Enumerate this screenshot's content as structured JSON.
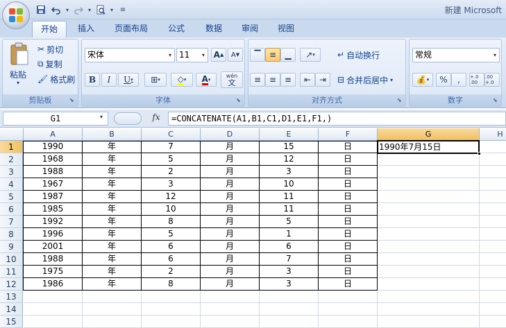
{
  "window": {
    "title": "新建 Microsoft"
  },
  "quick_access": {
    "save": "save-icon",
    "undo": "undo-icon",
    "redo": "redo-icon",
    "preview": "print-preview-icon"
  },
  "tabs": [
    "开始",
    "插入",
    "页面布局",
    "公式",
    "数据",
    "审阅",
    "视图"
  ],
  "ribbon": {
    "clipboard": {
      "paste": "粘贴",
      "cut": "剪切",
      "copy": "复制",
      "format_painter": "格式刷",
      "label": "剪贴板"
    },
    "font": {
      "name": "宋体",
      "size": "11",
      "label": "字体",
      "bold": "B",
      "italic": "I",
      "underline": "U",
      "font_color_letter": "A",
      "phonetic": "wén",
      "phonetic_char": "文"
    },
    "alignment": {
      "wrap": "自动换行",
      "merge": "合并后居中",
      "label": "对齐方式"
    },
    "number": {
      "format": "常规",
      "percent": "%",
      "comma": ",",
      "inc_decimal": "+.0 .00",
      "dec_decimal": ".00 +.0",
      "label": "数字"
    },
    "grow_font": "A",
    "shrink_font": "A"
  },
  "formula_bar": {
    "name_box": "G1",
    "fx": "fx",
    "formula": "=CONCATENATE(A1,B1,C1,D1,E1,F1,)"
  },
  "columns": [
    "A",
    "B",
    "C",
    "D",
    "E",
    "F",
    "G",
    "H"
  ],
  "rows": [
    {
      "n": "1",
      "cells": [
        "1990",
        "年",
        "7",
        "月",
        "15",
        "日"
      ]
    },
    {
      "n": "2",
      "cells": [
        "1968",
        "年",
        "5",
        "月",
        "12",
        "日"
      ]
    },
    {
      "n": "3",
      "cells": [
        "1988",
        "年",
        "2",
        "月",
        "3",
        "日"
      ]
    },
    {
      "n": "4",
      "cells": [
        "1967",
        "年",
        "3",
        "月",
        "10",
        "日"
      ]
    },
    {
      "n": "5",
      "cells": [
        "1987",
        "年",
        "12",
        "月",
        "11",
        "日"
      ]
    },
    {
      "n": "6",
      "cells": [
        "1985",
        "年",
        "10",
        "月",
        "11",
        "日"
      ]
    },
    {
      "n": "7",
      "cells": [
        "1992",
        "年",
        "8",
        "月",
        "5",
        "日"
      ]
    },
    {
      "n": "8",
      "cells": [
        "1996",
        "年",
        "5",
        "月",
        "1",
        "日"
      ]
    },
    {
      "n": "9",
      "cells": [
        "2001",
        "年",
        "6",
        "月",
        "6",
        "日"
      ]
    },
    {
      "n": "10",
      "cells": [
        "1988",
        "年",
        "6",
        "月",
        "7",
        "日"
      ]
    },
    {
      "n": "11",
      "cells": [
        "1975",
        "年",
        "2",
        "月",
        "3",
        "日"
      ]
    },
    {
      "n": "12",
      "cells": [
        "1986",
        "年",
        "8",
        "月",
        "3",
        "日"
      ]
    },
    {
      "n": "13",
      "cells": []
    },
    {
      "n": "14",
      "cells": []
    },
    {
      "n": "15",
      "cells": []
    }
  ],
  "active_cell": {
    "ref": "G1",
    "value": "1990年7月15日"
  },
  "colors": {
    "ribbon": "#d4e2f4",
    "selected_header": "#f1c15f",
    "tab_text": "#15428b"
  }
}
